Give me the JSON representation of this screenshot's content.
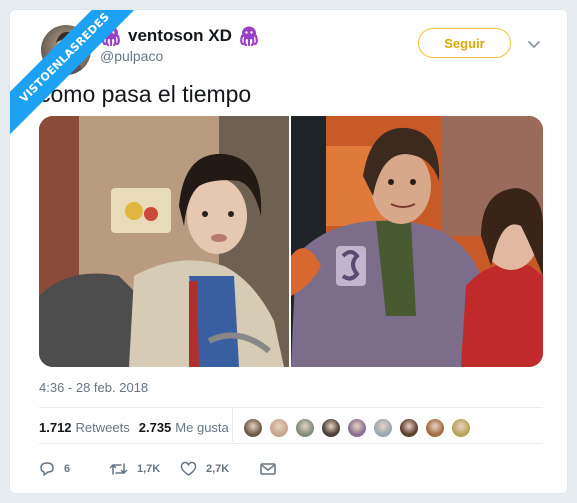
{
  "watermark": {
    "text": "VISTOENLASREDES"
  },
  "user": {
    "display_name": "ventoson XD",
    "handle": "@pulpaco",
    "emoji_icon": "octopus-icon"
  },
  "follow_button": {
    "label": "Seguir"
  },
  "tweet": {
    "text": "como pasa el tiempo",
    "timestamp": "4:36 - 28 feb. 2018"
  },
  "stats": {
    "retweets_count": "1.712",
    "retweets_label": "Retweets",
    "likes_count": "2.735",
    "likes_label": "Me gusta"
  },
  "likers": [
    "#6b5a4a",
    "#c9a48c",
    "#7f8c7a",
    "#4a3f38",
    "#8a6f8f",
    "#9aa7b0",
    "#5c3d2e",
    "#a36c44",
    "#b7a25a"
  ],
  "actions": {
    "reply_count": "6",
    "retweet_count": "1,7K",
    "like_count": "2,7K"
  },
  "colors": {
    "brand_blue": "#1da1f2",
    "octopus": "#9b3fc4",
    "follow_yellow": "#f5c43a",
    "secondary_text": "#657786"
  }
}
